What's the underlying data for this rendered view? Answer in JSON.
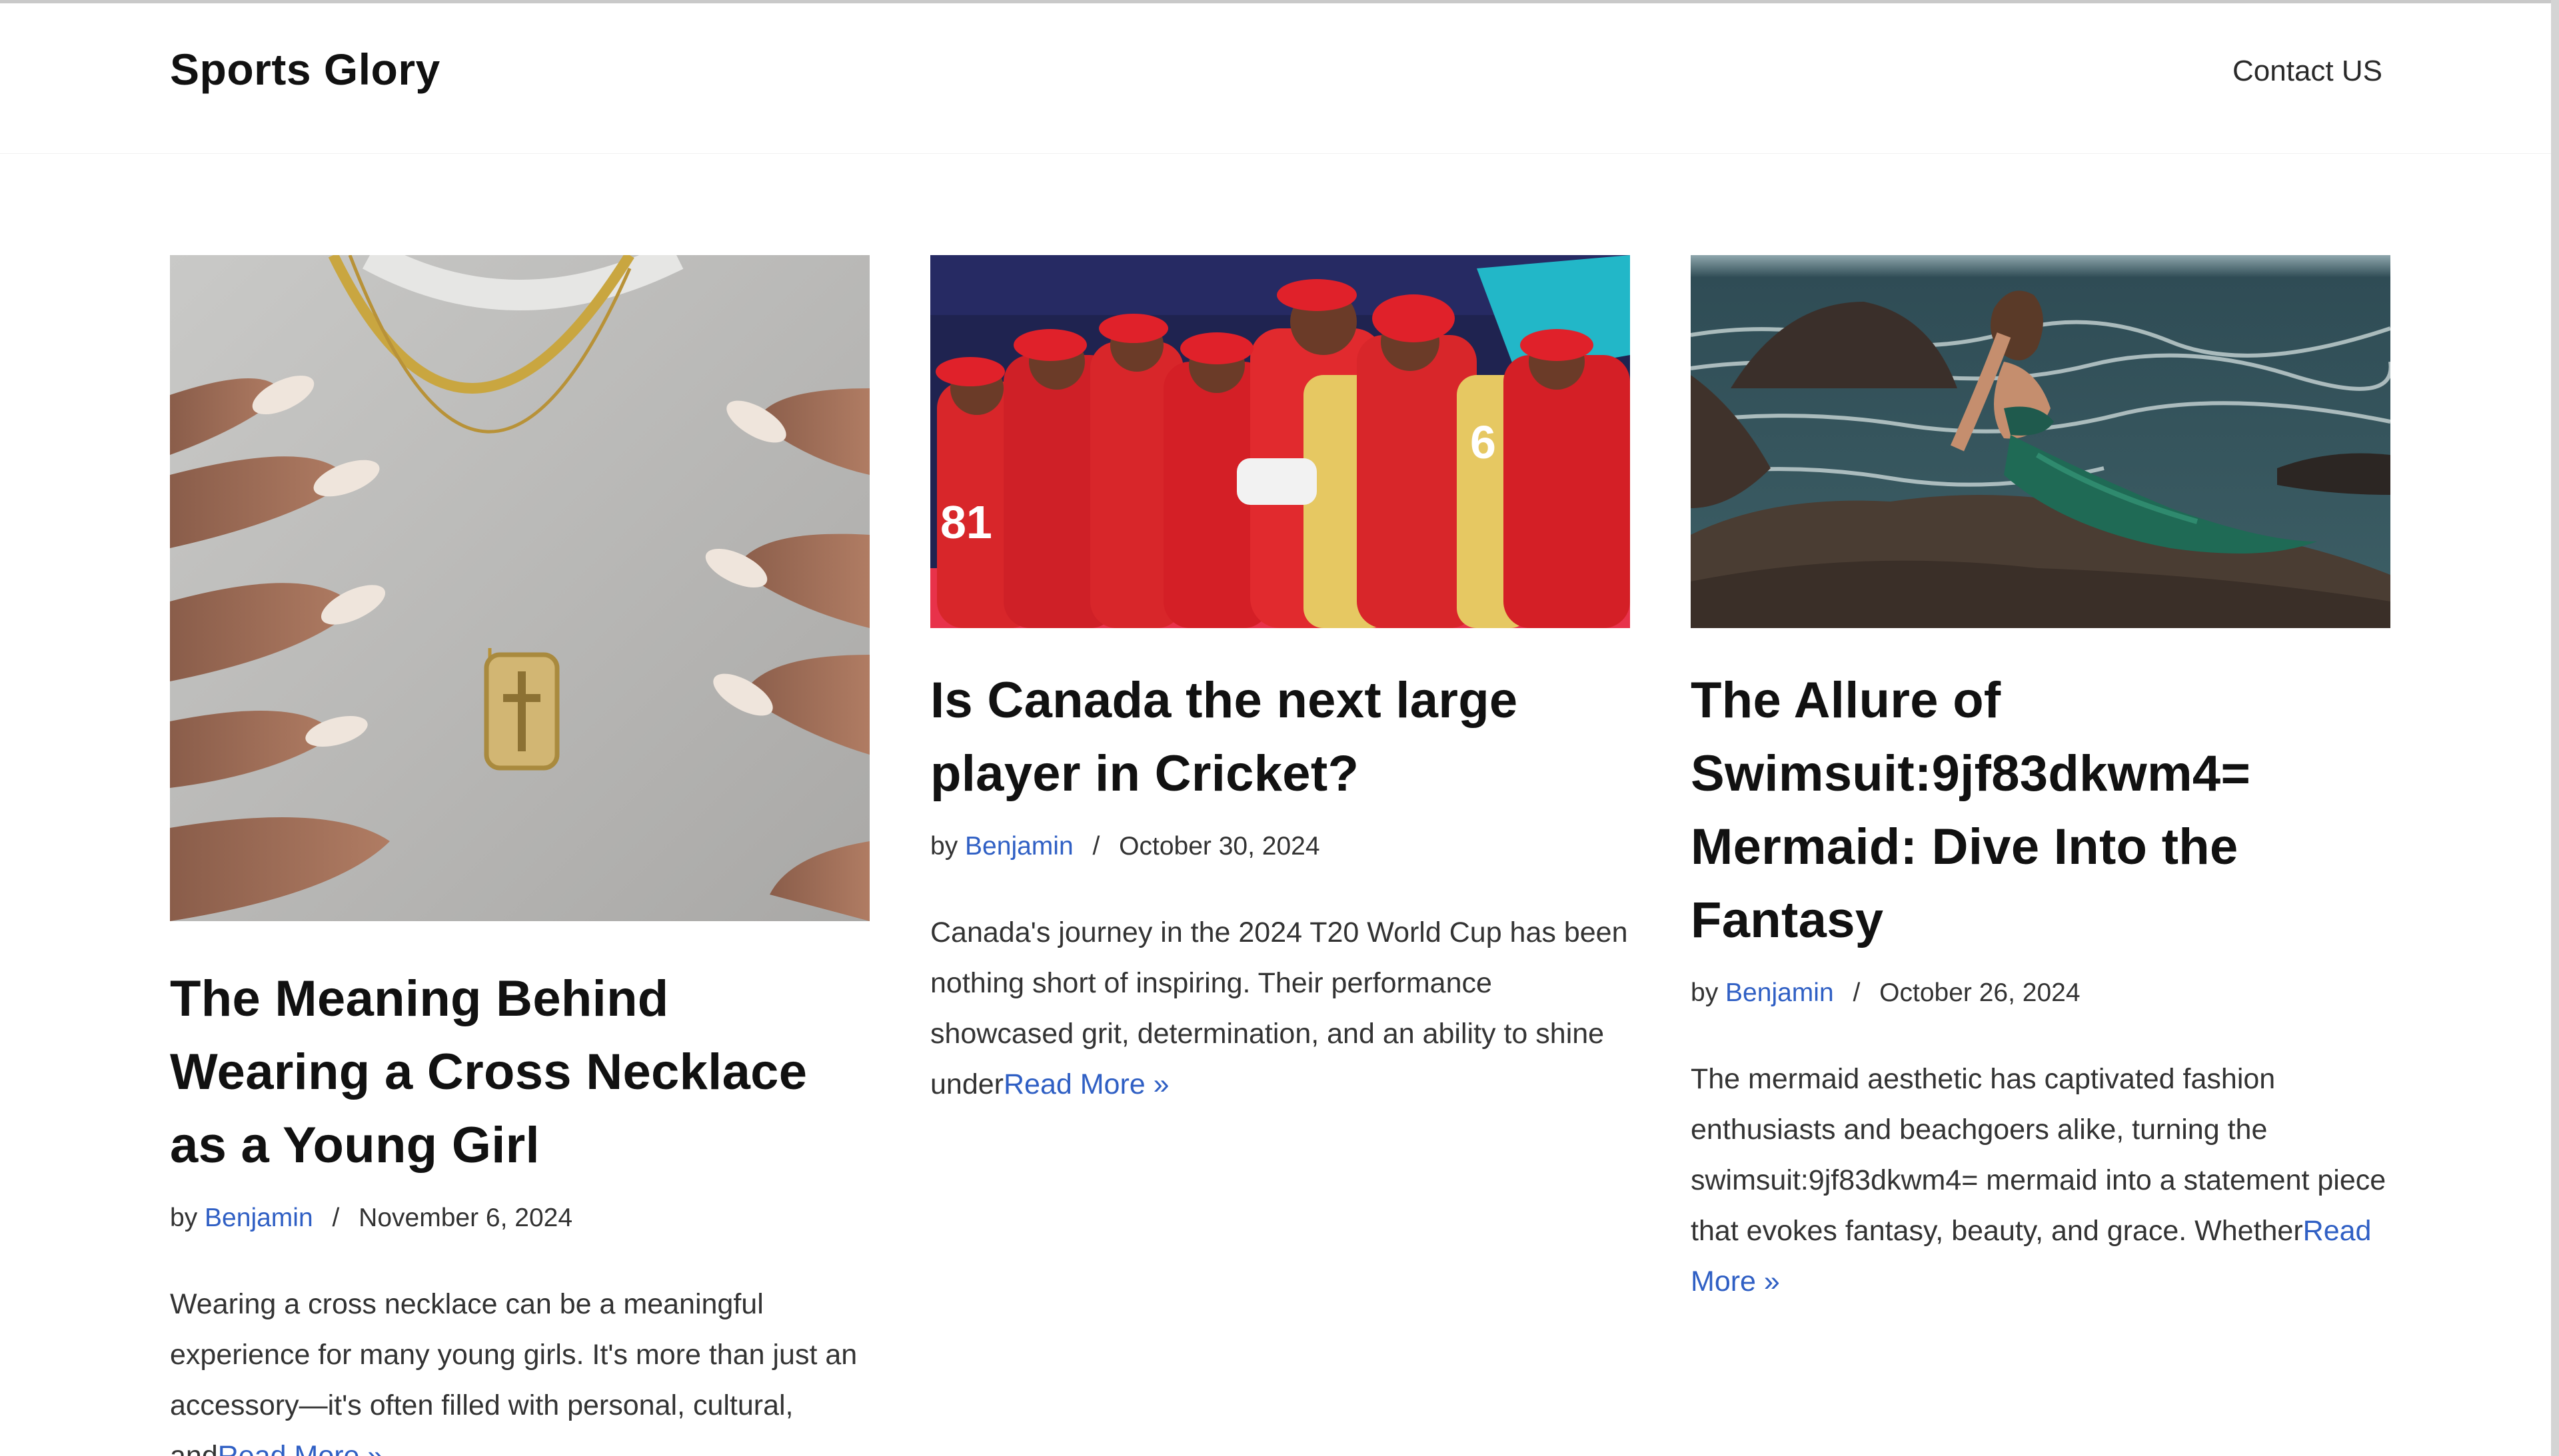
{
  "site": {
    "title": "Sports Glory",
    "nav": {
      "contact": "Contact US"
    }
  },
  "colors": {
    "link": "#2f5fc4",
    "text": "#111111",
    "muted": "#333333"
  },
  "posts": [
    {
      "title": "The Meaning Behind Wearing a Cross Necklace as a Young Girl",
      "by": "by",
      "author": "Benjamin",
      "separator": "/",
      "date": "November 6, 2024",
      "excerpt": "Wearing a cross necklace can be a meaningful experience for many young girls. It's more than just an accessory—it's often filled with personal, cultural, and",
      "read_more": "Read More »",
      "image": "photo of gold chain necklaces with cross pendant and manicured hands"
    },
    {
      "title": "Is Canada the next large player in Cricket?",
      "by": "by",
      "author": "Benjamin",
      "separator": "/",
      "date": "October 30, 2024",
      "excerpt": "Canada's journey in the 2024 T20 World Cup has been nothing short of inspiring. Their performance showcased grit, determination, and an ability to shine under",
      "read_more": "Read More »",
      "image": "photo of cricket team in red and yellow uniforms celebrating"
    },
    {
      "title": "The Allure of Swimsuit:9jf83dkwm4= Mermaid: Dive Into the Fantasy",
      "by": "by",
      "author": "Benjamin",
      "separator": "/",
      "date": "October 26, 2024",
      "excerpt": "The mermaid aesthetic has captivated fashion enthusiasts and beachgoers alike, turning the swimsuit:9jf83dkwm4= mermaid into a statement piece that evokes fantasy, beauty, and grace. Whether",
      "read_more": "Read More »",
      "image": "photo of woman in green mermaid outfit sitting on rocks by the sea"
    }
  ]
}
